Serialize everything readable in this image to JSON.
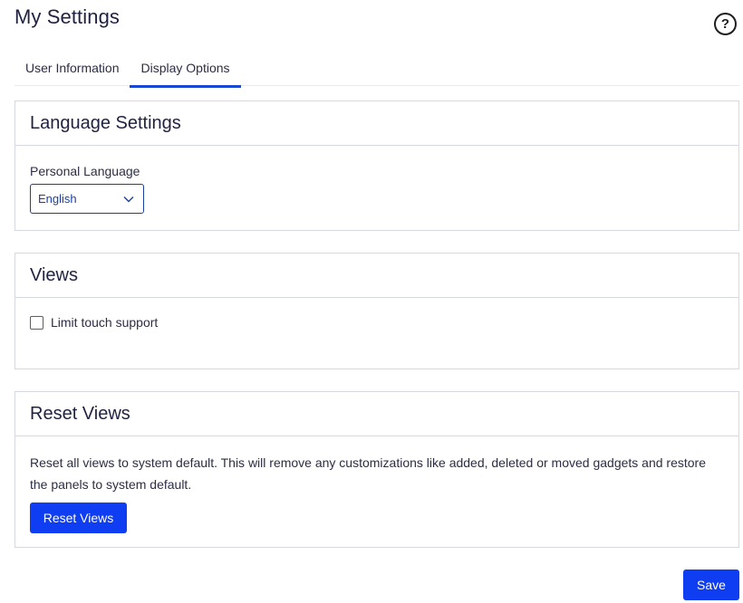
{
  "page": {
    "title": "My Settings",
    "help_icon": "help-circle-icon",
    "help_glyph": "?"
  },
  "tabs": [
    {
      "label": "User Information",
      "active": false
    },
    {
      "label": "Display Options",
      "active": true
    }
  ],
  "language_settings": {
    "heading": "Language Settings",
    "field_label": "Personal Language",
    "selected_value": "English",
    "dropdown_icon": "chevron-down-icon"
  },
  "views": {
    "heading": "Views",
    "checkbox_label": "Limit touch support",
    "checked": false
  },
  "reset_views": {
    "heading": "Reset Views",
    "description": "Reset all views to system default. This will remove any customizations like added, deleted or moved gadgets and restore the panels to system default.",
    "button_label": "Reset Views"
  },
  "footer": {
    "save_label": "Save"
  },
  "colors": {
    "accent": "#1a47d1",
    "primary_button": "#0f3df2",
    "border": "#d6d9df",
    "text": "#1f2240"
  }
}
